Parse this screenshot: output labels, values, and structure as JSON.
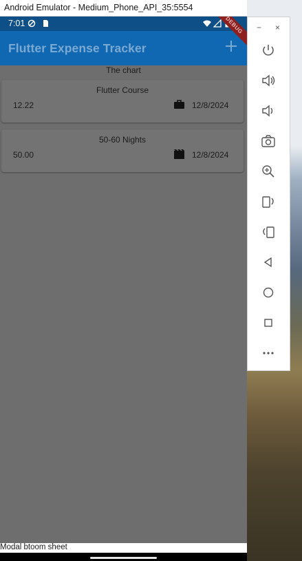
{
  "window": {
    "title": "Android Emulator - Medium_Phone_API_35:5554"
  },
  "status_bar": {
    "time": "7:01"
  },
  "app_bar": {
    "title": "Flutter Expense Tracker",
    "add_icon": "plus-icon",
    "debug_banner": "DEBUG"
  },
  "main": {
    "chart_label": "The chart",
    "expenses": [
      {
        "title": "Flutter Course",
        "amount": "12.22",
        "category_icon": "briefcase-icon",
        "date": "12/8/2024"
      },
      {
        "title": "50-60 Nights",
        "amount": "50.00",
        "category_icon": "movie-icon",
        "date": "12/8/2024"
      }
    ]
  },
  "bottom_sheet": {
    "label": "Modal btoom sheet"
  },
  "emulator_toolbar": {
    "minimize_label": "−",
    "close_label": "×",
    "buttons": [
      "power-icon",
      "volume-up-icon",
      "volume-down-icon",
      "camera-icon",
      "zoom-icon",
      "rotate-left-icon",
      "rotate-right-icon",
      "back-icon",
      "home-icon",
      "overview-icon",
      "more-icon"
    ]
  },
  "colors": {
    "app_bar": "#1168b2",
    "status_bar": "#0d4f86",
    "scrim_background": "#6e6e6e"
  }
}
